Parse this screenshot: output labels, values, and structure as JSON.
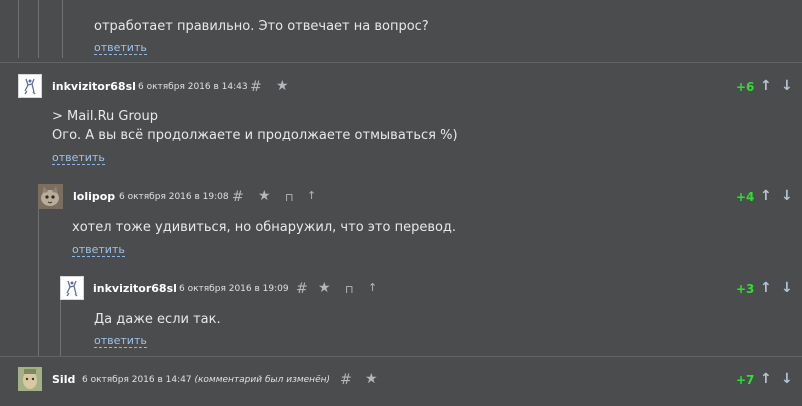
{
  "top_comment": {
    "text": "отработает правильно. Это отвечает на вопрос?",
    "reply_label": "ответить"
  },
  "comments": [
    {
      "username": "inkvizitor68sl",
      "date": "6 октября 2016 в 14:43",
      "score": "+6",
      "lines": [
        "> Mail.Ru Group",
        "Ого. А вы всё продолжаете и продолжаете отмываться %)"
      ],
      "reply_label": "ответить"
    },
    {
      "username": "lolipop",
      "date": "6 октября 2016 в 19:08",
      "score": "+4",
      "lines": [
        "хотел тоже удивиться, но обнаружил, что это перевод."
      ],
      "reply_label": "ответить"
    },
    {
      "username": "inkvizitor68sl",
      "date": "6 октября 2016 в 19:09",
      "score": "+3",
      "lines": [
        "Да даже если так."
      ],
      "reply_label": "ответить"
    },
    {
      "username": "Sild",
      "date": "6 октября 2016 в 14:47",
      "edited_note": "(комментарий был изменён)",
      "score": "+7",
      "lines": []
    }
  ],
  "icons": {
    "anchor": "hash-icon",
    "favorite": "star-icon",
    "to_parent": "parent-link-icon",
    "up_tree": "arrow-up-small-icon",
    "vote_up": "arrow-up-icon",
    "vote_down": "arrow-down-icon"
  },
  "colors": {
    "background": "#4b4c4e",
    "score_positive": "#2de02d",
    "link": "#9ec3ea"
  }
}
